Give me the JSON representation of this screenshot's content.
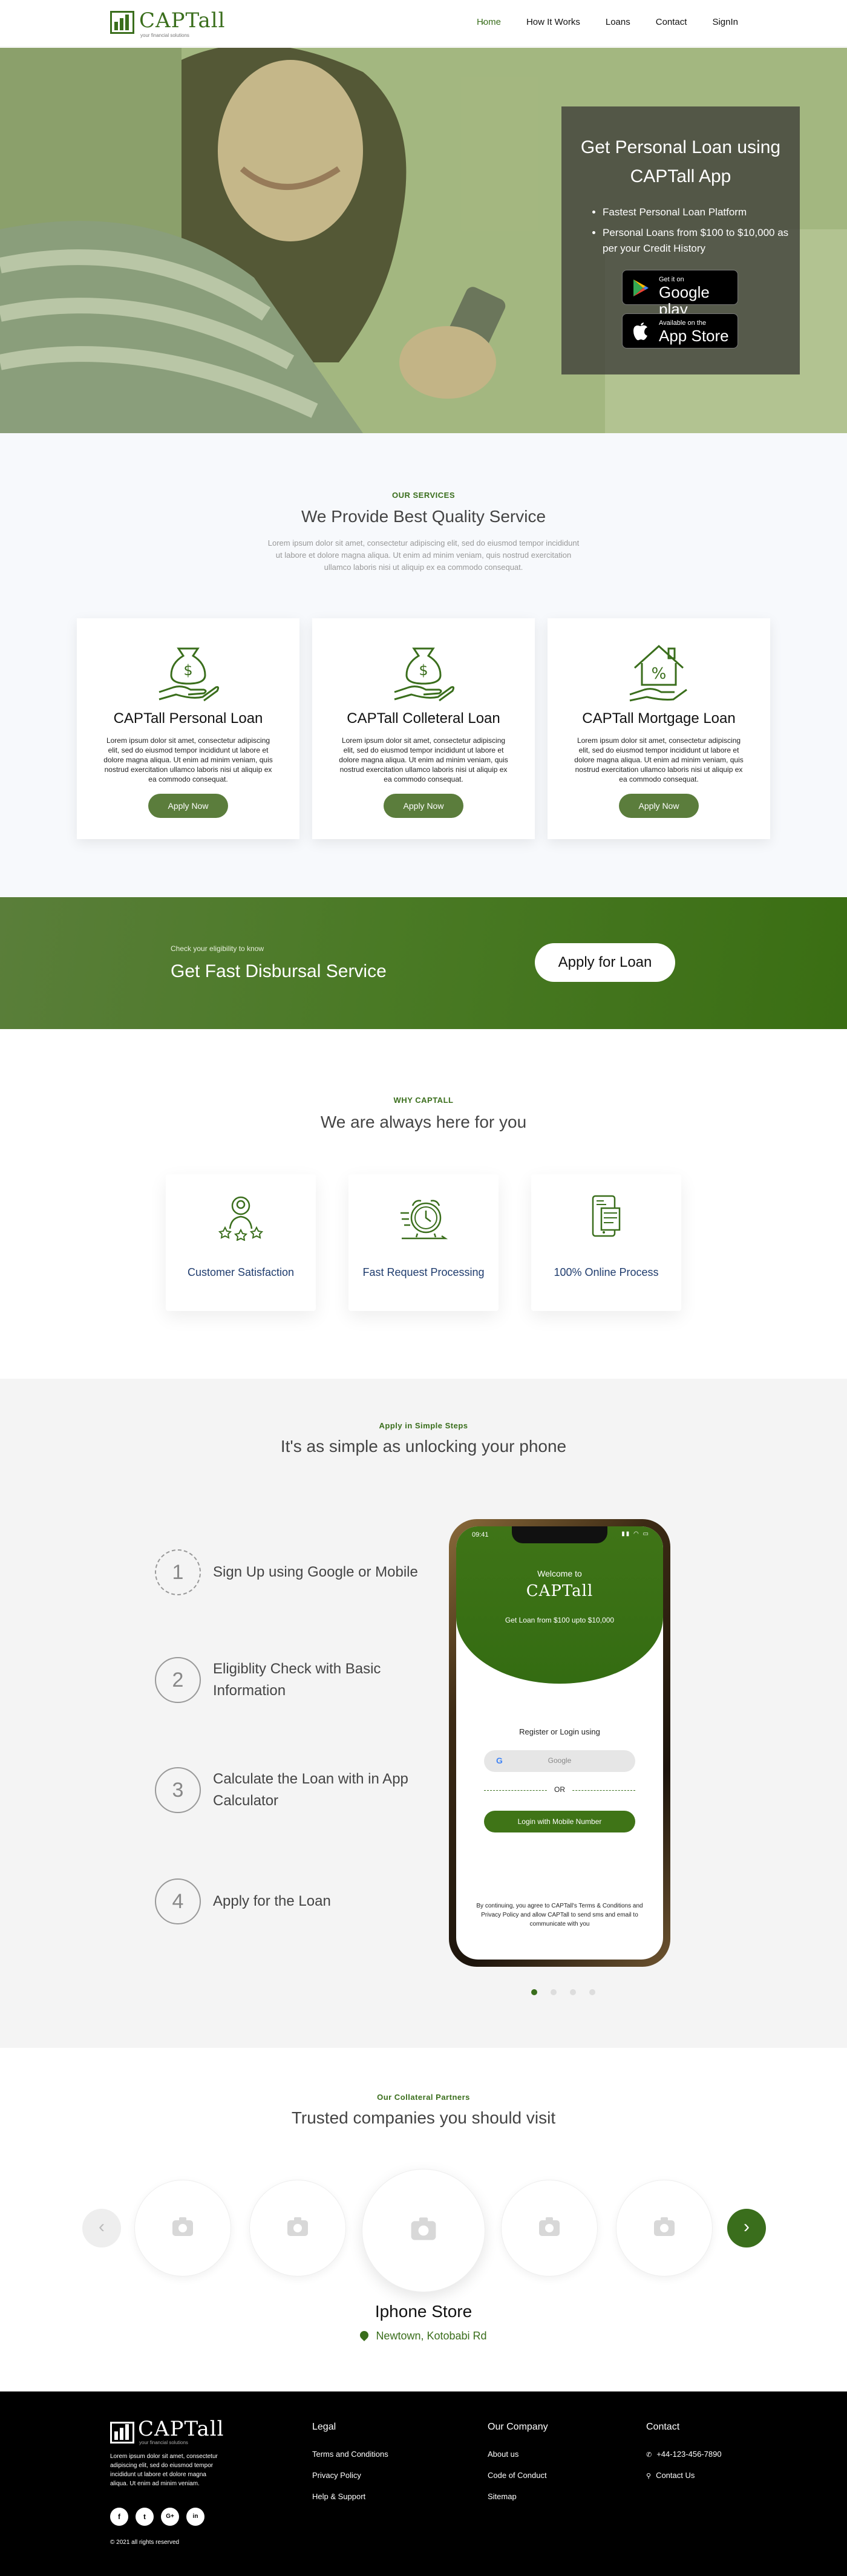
{
  "header": {
    "brand": "CAPTall",
    "tagline": "your financial solutions",
    "nav": [
      "Home",
      "How It Works",
      "Loans",
      "Contact",
      "SignIn"
    ]
  },
  "hero": {
    "title": "Get Personal Loan using CAPTall App",
    "bullets": [
      "Fastest Personal Loan Platform",
      "Personal Loans from $100 to $10,000 as per your Credit History"
    ],
    "google_small": "Get it on",
    "google_big": "Google play",
    "apple_small": "Available on the",
    "apple_big": "App Store"
  },
  "services": {
    "kicker": "OUR SERVICES",
    "title": "We Provide Best Quality Service",
    "lead": "Lorem ipsum dolor sit amet, consectetur adipiscing elit, sed do eiusmod tempor incididunt ut labore et dolore magna aliqua. Ut enim ad minim veniam, quis nostrud exercitation ullamco laboris nisi ut aliquip ex ea commodo consequat.",
    "cards": [
      {
        "title": "CAPTall Personal Loan",
        "body": "Lorem ipsum dolor sit amet, consectetur adipiscing elit, sed do eiusmod tempor incididunt ut labore et dolore magna aliqua. Ut enim ad minim veniam, quis nostrud exercitation ullamco laboris nisi ut aliquip ex ea commodo consequat.",
        "button": "Apply Now"
      },
      {
        "title": "CAPTall Colleteral Loan",
        "body": "Lorem ipsum dolor sit amet, consectetur adipiscing elit, sed do eiusmod tempor incididunt ut labore et dolore magna aliqua. Ut enim ad minim veniam, quis nostrud exercitation ullamco laboris nisi ut aliquip ex ea commodo consequat.",
        "button": "Apply Now"
      },
      {
        "title": "CAPTall Mortgage Loan",
        "body": "Lorem ipsum dolor sit amet, consectetur adipiscing elit, sed do eiusmod tempor incididunt ut labore et dolore magna aliqua. Ut enim ad minim veniam, quis nostrud exercitation ullamco laboris nisi ut aliquip ex ea commodo consequat.",
        "button": "Apply Now"
      }
    ]
  },
  "cta": {
    "kicker": "Check your eligibility to know",
    "title": "Get Fast Disbursal Service",
    "button": "Apply for Loan"
  },
  "why": {
    "kicker": "WHY CAPTALL",
    "title": "We are always here for you",
    "cards": [
      "Customer Satisfaction",
      "Fast Request Processing",
      "100% Online Process"
    ]
  },
  "steps": {
    "kicker": "Apply in Simple Steps",
    "title": "It's as simple as unlocking your phone",
    "items": [
      {
        "num": "1",
        "text": "Sign Up using Google or Mobile"
      },
      {
        "num": "2",
        "text": "Eligiblity Check with Basic Information"
      },
      {
        "num": "3",
        "text": "Calculate the Loan with in App Calculator"
      },
      {
        "num": "4",
        "text": "Apply for the Loan"
      }
    ],
    "phone": {
      "time": "09:41",
      "welcome": "Welcome to",
      "brand": "CAPTall",
      "offer": "Get Loan from $100 upto $10,000",
      "register": "Register or Login using",
      "google": "Google",
      "or": "OR",
      "mobile_btn": "Login with Mobile Number",
      "terms": "By continuing, you agree to CAPTall's Terms & Conditions and Privacy Policy and allow CAPTall to send sms and email to communicate with you"
    }
  },
  "partners": {
    "kicker": "Our Collateral Partners",
    "title": "Trusted companies you should visit",
    "featured_name": "Iphone Store",
    "featured_location": "Newtown, Kotobabi Rd"
  },
  "footer": {
    "brand": "CAPTall",
    "tagline": "your financial solutions",
    "about": "Lorem ipsum dolor sit amet, consectetur adipiscing elit, sed do eiusmod tempor incididunt ut labore et dolore magna aliqua. Ut enim ad minim veniam.",
    "copyright": "© 2021 all rights reserved",
    "legal": {
      "title": "Legal",
      "links": [
        "Terms and Conditions",
        "Privacy Policy",
        "Help & Support"
      ]
    },
    "company": {
      "title": "Our Company",
      "links": [
        "About us",
        "Code of Conduct",
        "Sitemap"
      ]
    },
    "contact": {
      "title": "Contact",
      "phone": "+44-123-456-7890",
      "link": "Contact Us"
    },
    "social": [
      "f",
      "t",
      "G+",
      "in"
    ]
  },
  "colors": {
    "brand_green": "#3a6e1c",
    "button_green": "#5b7d3c",
    "footer_bg": "#000000"
  }
}
